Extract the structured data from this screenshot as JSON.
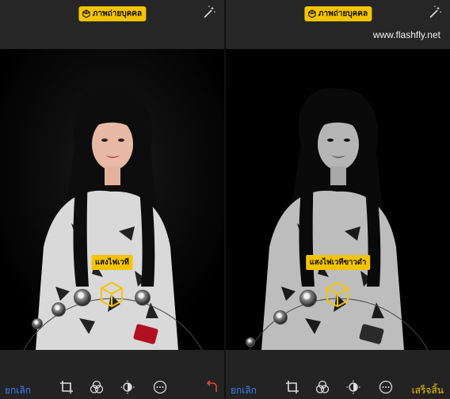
{
  "left": {
    "mode_badge": "ภาพถ่ายบุคคล",
    "lighting_label": "แสงไฟเวที",
    "cancel_label": "ยกเลิก",
    "tools": [
      "crop-icon",
      "filters-icon",
      "adjust-icon",
      "more-icon",
      "revert-icon"
    ]
  },
  "right": {
    "mode_badge": "ภาพถ่ายบุคคล",
    "lighting_label": "แสงไฟเวทีขาวดำ",
    "cancel_label": "ยกเลิก",
    "done_label": "เสร็จสิ้น",
    "watermark": "www.flashfly.net",
    "tools": [
      "crop-icon",
      "filters-icon",
      "adjust-icon",
      "more-icon"
    ]
  },
  "colors": {
    "accent": "#f5c400",
    "link": "#3b82f6",
    "revert": "#e0483e"
  }
}
